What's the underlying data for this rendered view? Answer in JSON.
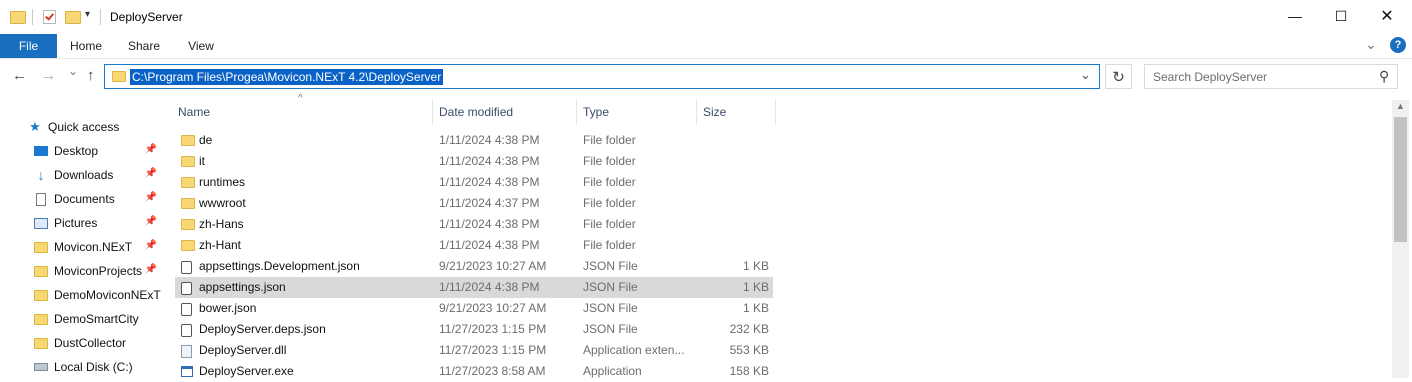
{
  "window": {
    "title": "DeployServer",
    "minimize": "—",
    "maximize": "☐",
    "close": "✕"
  },
  "ribbon": {
    "tabs": [
      "File",
      "Home",
      "Share",
      "View"
    ],
    "expand": "⌄",
    "help": "?"
  },
  "nav": {
    "back": "←",
    "forward": "→",
    "recent": "⌄",
    "up": "↑",
    "address": "C:\\Program Files\\Progea\\Movicon.NExT 4.2\\DeployServer",
    "address_dropdown": "⌄",
    "refresh": "↻",
    "search_placeholder": "Search DeployServer",
    "search_icon": "⚲"
  },
  "sidebar": {
    "items": [
      {
        "label": "Quick access",
        "icon": "star-icon",
        "pinned": false
      },
      {
        "label": "Desktop",
        "icon": "desktop-icon",
        "pinned": true
      },
      {
        "label": "Downloads",
        "icon": "download-icon",
        "pinned": true
      },
      {
        "label": "Documents",
        "icon": "documents-icon",
        "pinned": true
      },
      {
        "label": "Pictures",
        "icon": "pictures-icon",
        "pinned": true
      },
      {
        "label": "Movicon.NExT",
        "icon": "folder-icon",
        "pinned": true
      },
      {
        "label": "MoviconProjects",
        "icon": "folder-icon",
        "pinned": true
      },
      {
        "label": "DemoMoviconNExT",
        "icon": "folder-icon",
        "pinned": false
      },
      {
        "label": "DemoSmartCity",
        "icon": "folder-icon",
        "pinned": false
      },
      {
        "label": "DustCollector",
        "icon": "folder-icon",
        "pinned": false
      },
      {
        "label": "Local Disk (C:)",
        "icon": "drive-icon",
        "pinned": false
      }
    ],
    "pin_glyph": "📌"
  },
  "columns": {
    "name": "Name",
    "date": "Date modified",
    "type": "Type",
    "size": "Size",
    "sort_indicator": "^"
  },
  "files": [
    {
      "name": "de",
      "date": "1/11/2024 4:38 PM",
      "type": "File folder",
      "size": "",
      "icon": "folder-icon"
    },
    {
      "name": "it",
      "date": "1/11/2024 4:38 PM",
      "type": "File folder",
      "size": "",
      "icon": "folder-icon"
    },
    {
      "name": "runtimes",
      "date": "1/11/2024 4:38 PM",
      "type": "File folder",
      "size": "",
      "icon": "folder-icon"
    },
    {
      "name": "wwwroot",
      "date": "1/11/2024 4:37 PM",
      "type": "File folder",
      "size": "",
      "icon": "folder-icon"
    },
    {
      "name": "zh-Hans",
      "date": "1/11/2024 4:38 PM",
      "type": "File folder",
      "size": "",
      "icon": "folder-icon"
    },
    {
      "name": "zh-Hant",
      "date": "1/11/2024 4:38 PM",
      "type": "File folder",
      "size": "",
      "icon": "folder-icon"
    },
    {
      "name": "appsettings.Development.json",
      "date": "9/21/2023 10:27 AM",
      "type": "JSON File",
      "size": "1 KB",
      "icon": "json-file-icon"
    },
    {
      "name": "appsettings.json",
      "date": "1/11/2024 4:38 PM",
      "type": "JSON File",
      "size": "1 KB",
      "icon": "json-file-icon",
      "selected": true
    },
    {
      "name": "bower.json",
      "date": "9/21/2023 10:27 AM",
      "type": "JSON File",
      "size": "1 KB",
      "icon": "json-file-icon"
    },
    {
      "name": "DeployServer.deps.json",
      "date": "11/27/2023 1:15 PM",
      "type": "JSON File",
      "size": "232 KB",
      "icon": "json-file-icon"
    },
    {
      "name": "DeployServer.dll",
      "date": "11/27/2023 1:15 PM",
      "type": "Application exten...",
      "size": "553 KB",
      "icon": "dll-file-icon"
    },
    {
      "name": "DeployServer.exe",
      "date": "11/27/2023 8:58 AM",
      "type": "Application",
      "size": "158 KB",
      "icon": "exe-file-icon"
    }
  ]
}
